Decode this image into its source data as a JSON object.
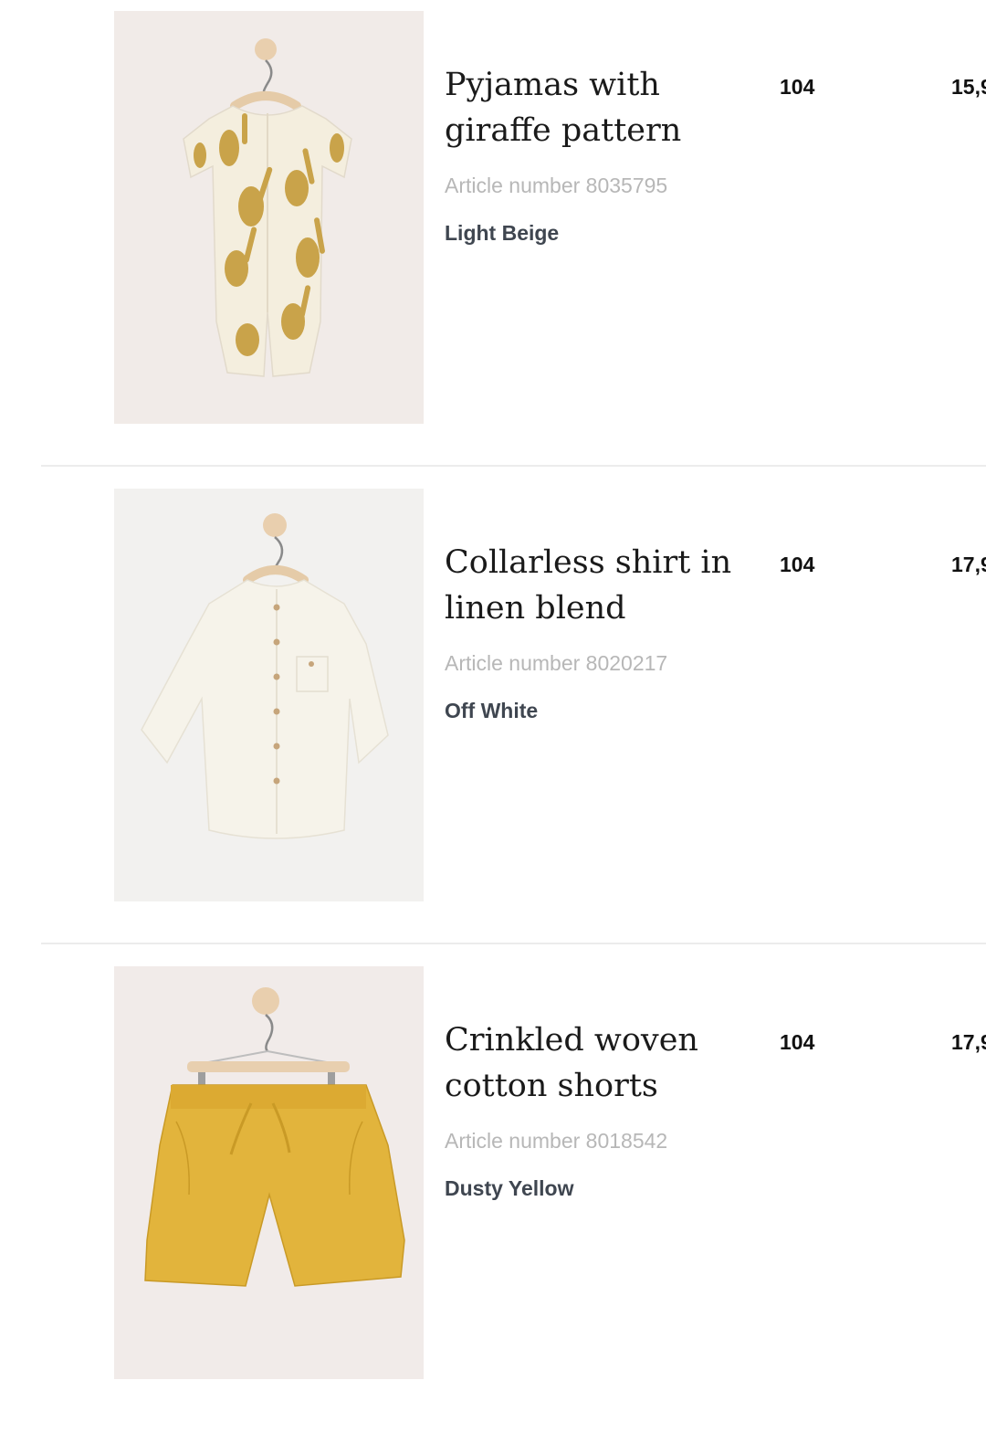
{
  "products": [
    {
      "title": "Pyjamas with giraffe pattern",
      "article_number": "Article number 8035795",
      "color": "Light Beige",
      "size": "104",
      "price": "15,9",
      "image": "giraffe-pyjamas-image"
    },
    {
      "title": "Collarless shirt in linen blend",
      "article_number": "Article number 8020217",
      "color": "Off White",
      "size": "104",
      "price": "17,9",
      "image": "linen-shirt-image"
    },
    {
      "title": "Crinkled woven cotton shorts",
      "article_number": "Article number 8018542",
      "color": "Dusty Yellow",
      "size": "104",
      "price": "17,9",
      "image": "yellow-shorts-image"
    }
  ],
  "colors": {
    "image_background": "#f2ecea",
    "divider": "#ececec",
    "article_text": "#b7b7b7",
    "color_text": "#3f4650",
    "title_text": "#1a1a1a",
    "pyjama_fabric": "#f3ede0",
    "giraffe": "#c9a44a",
    "shirt_fabric": "#f5f2ea",
    "shorts_fabric": "#e2b43c"
  }
}
